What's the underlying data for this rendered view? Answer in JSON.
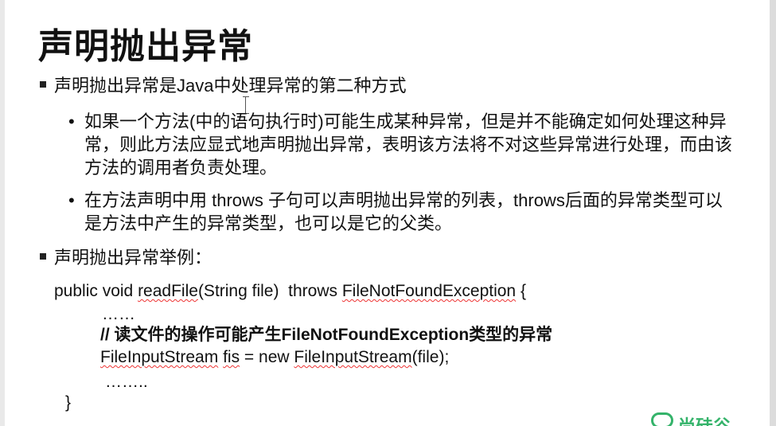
{
  "slide": {
    "title": "声明抛出异常",
    "bullet1": "声明抛出异常是Java中处理异常的第二种方式",
    "sub1": "如果一个方法(中的语句执行时)可能生成某种异常，但是并不能确定如何处理这种异常，则此方法应显式地声明抛出异常，表明该方法将不对这些异常进行处理，而由该方法的调用者负责处理。",
    "sub2": "在方法声明中用 throws 子句可以声明抛出异常的列表，throws后面的异常类型可以是方法中产生的异常类型，也可以是它的父类。",
    "bullet2": "声明抛出异常举例：",
    "sub_marker": "•",
    "code": {
      "line1_a": "public void ",
      "line1_b": "readFile",
      "line1_c": "(String file)  throws ",
      "line1_d": "FileNotFoundException",
      "line1_e": " {",
      "line2": "……",
      "line3": "// 读文件的操作可能产生FileNotFoundException类型的异常",
      "line4_a": "FileInputStream",
      "line4_b": " ",
      "line4_c": "fis",
      "line4_d": " = new ",
      "line4_e": "FileInputStream",
      "line4_f": "(file);",
      "line5": "……..",
      "line6": "}"
    }
  },
  "watermark": {
    "text": "尚硅谷"
  },
  "colors": {
    "background": "#ffffff",
    "text": "#111111",
    "spellcheck_underline": "#e33333",
    "watermark": "#34b36a"
  }
}
